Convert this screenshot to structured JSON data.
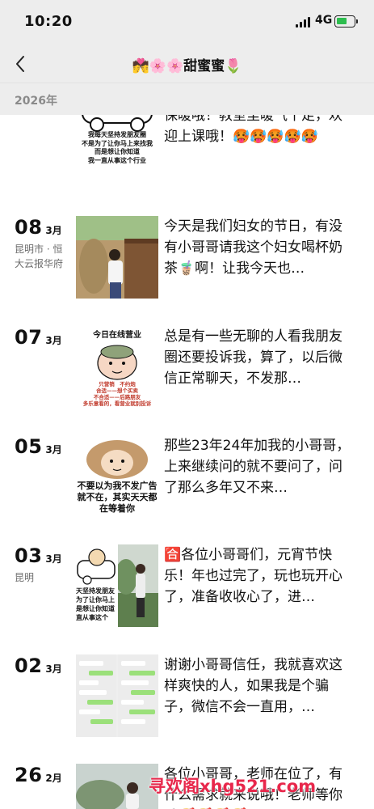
{
  "status_bar": {
    "time": "10:20",
    "network": "4G",
    "battery_charging": true,
    "accent_color": "#2dbd4e"
  },
  "nav": {
    "title": "💏🌸🌸甜蜜蜜🌷",
    "back_icon": "chevron-left-icon"
  },
  "year_header": "2026年",
  "posts": [
    {
      "day": "",
      "month": "",
      "location": "",
      "text": "今天天气转凉，各位同学注意保暖哦！教室里暖气十足，欢迎上课哦！🥵🥵🥵🥵🥵",
      "thumb_caption": "我每天坚持发朋友圈\n不是为了让你马上来找我\n而是想让你知道\n我一直从事这个行业"
    },
    {
      "day": "08",
      "month": "3月",
      "location": "昆明市 · 恒大云报华府",
      "text": "今天是我们妇女的节日，有没有小哥哥请我这个妇女喝杯奶茶🧋啊！让我今天也…"
    },
    {
      "day": "07",
      "month": "3月",
      "location": "",
      "text": "总是有一些无聊的人看我朋友圈还要投诉我，算了，以后微信正常聊天，不发那…",
      "thumb_caption_top": "今日在线营业",
      "thumb_caption_bottom": "只营销　不约炮\n合适——想个买卖\n不合适——后路朋友\n多乐意看的，看营业就别投诉"
    },
    {
      "day": "05",
      "month": "3月",
      "location": "",
      "text": "那些23年24年加我的小哥哥，上来继续问的就不要问了，问了那么多年又不来…",
      "thumb_caption": "不要以为我不发广告就不在，其实天天都在等着你"
    },
    {
      "day": "03",
      "month": "3月",
      "location": "昆明",
      "text": "🈴各位小哥哥们，元宵节快乐！年也过完了，玩也玩开心了，准备收收心了，进…",
      "thumb_caption": "天坚持发朋友\n为了让你马上\n是想让你知道\n直从事这个"
    },
    {
      "day": "02",
      "month": "3月",
      "location": "",
      "text": "谢谢小哥哥信任，我就喜欢这样爽快的人，如果我是个骗子，微信不会一直用，…"
    },
    {
      "day": "26",
      "month": "2月",
      "location": "",
      "text": "各位小哥哥，老师在位了，有什么需求就来说哦！老师等你哦🥰🥰🥰🥰"
    }
  ],
  "watermark": "寻欢阁xhg521.com",
  "colors": {
    "header_bg": "#ededed",
    "watermark_red": "#e8274b",
    "location_gray": "#6b6b6b"
  }
}
